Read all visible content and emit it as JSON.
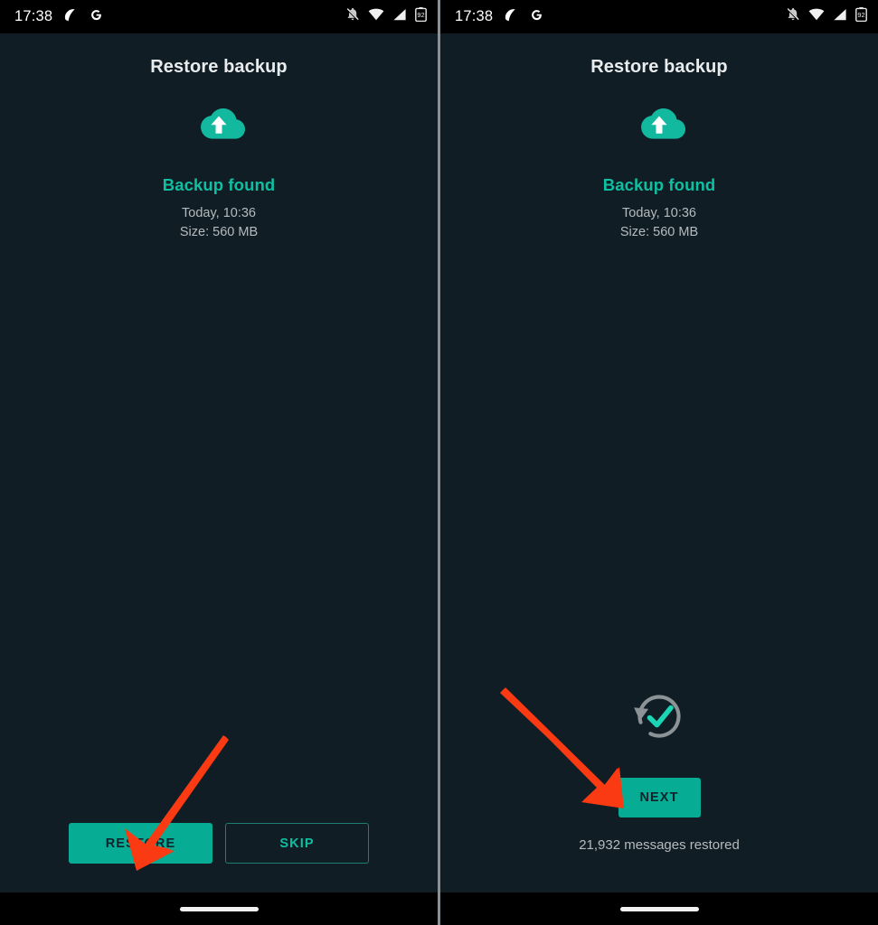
{
  "colors": {
    "background": "#111d25",
    "accent_teal": "#07ac94",
    "accent_text": "#0fbfa1",
    "arrow_red": "#f93a12",
    "muted_text": "#b4bbbe",
    "title_text": "#e9eced",
    "statusbar_bg": "#000000",
    "divider": "#8a9093"
  },
  "statusbar": {
    "time": "17:38",
    "notification_icons": [
      "app-glyph-icon",
      "google-g-icon"
    ],
    "system_icons": [
      "notifications-muted-icon",
      "wifi-icon",
      "cellular-signal-icon",
      "battery-icon"
    ],
    "battery_level": "92"
  },
  "screen_left": {
    "title": "Restore backup",
    "hero_icon": "cloud-upload-icon",
    "status_label": "Backup found",
    "backup_date": "Today, 10:36",
    "backup_size": "Size: 560 MB",
    "primary_button": "RESTORE",
    "secondary_button": "SKIP",
    "annotation": "red-arrow-pointing-to-restore-button"
  },
  "screen_right": {
    "title": "Restore backup",
    "hero_icon": "cloud-upload-icon",
    "status_label": "Backup found",
    "backup_date": "Today, 10:36",
    "backup_size": "Size: 560 MB",
    "restore_complete_icon": "restore-check-circle-icon",
    "primary_button": "NEXT",
    "restored_count": "21,932 messages restored",
    "annotation": "red-arrow-pointing-to-next-button"
  }
}
